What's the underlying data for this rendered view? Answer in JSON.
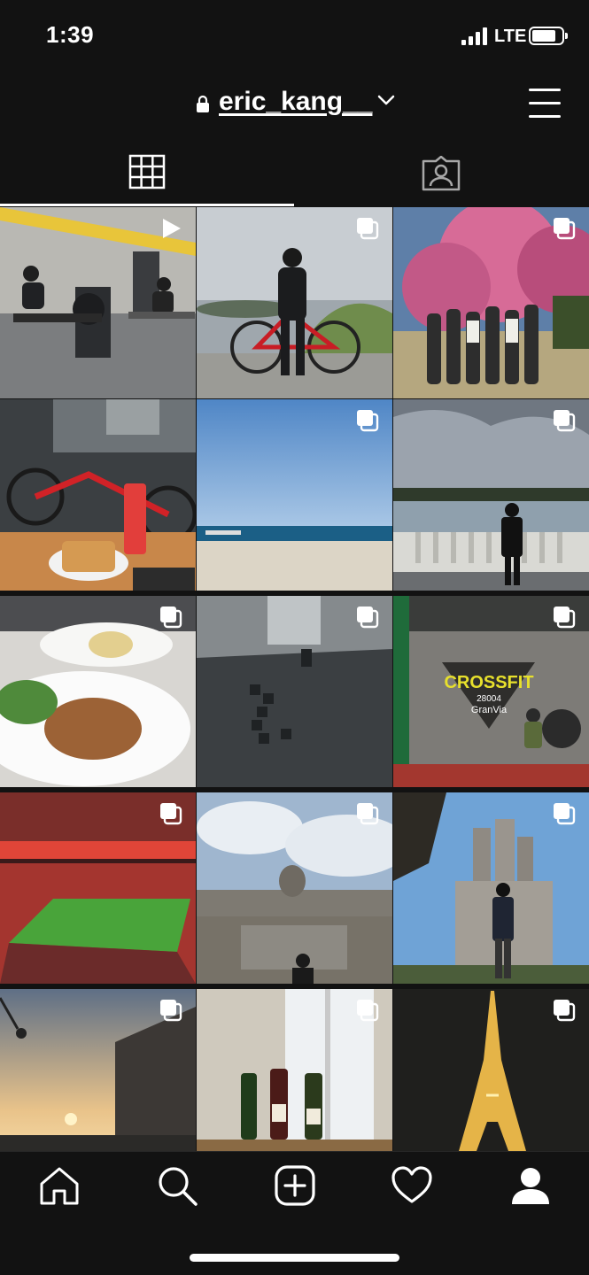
{
  "status_bar": {
    "time": "1:39",
    "network": "LTE"
  },
  "header": {
    "username": "eric_kang__"
  },
  "icons": {
    "lock": "lock-icon",
    "chevron": "chevron-down-icon",
    "menu": "hamburger-menu-icon",
    "grid_tab": "grid-icon",
    "tagged_tab": "tagged-person-icon",
    "home": "home-icon",
    "search": "search-icon",
    "create": "plus-square-icon",
    "activity": "heart-icon",
    "profile": "profile-icon"
  },
  "posts": [
    {
      "id": 1,
      "type": "reel",
      "scene": "gym"
    },
    {
      "id": 2,
      "type": "carousel",
      "scene": "cyclist-by-sea"
    },
    {
      "id": 3,
      "type": "carousel",
      "scene": "group-cherry-blossom"
    },
    {
      "id": 4,
      "type": "none",
      "scene": "cafe-bike-sandwich"
    },
    {
      "id": 5,
      "type": "carousel",
      "scene": "beach"
    },
    {
      "id": 6,
      "type": "carousel",
      "scene": "lake-balustrade"
    },
    {
      "id": 7,
      "type": "carousel",
      "scene": "duck-confit-plate"
    },
    {
      "id": 8,
      "type": "carousel",
      "scene": "city-model"
    },
    {
      "id": 9,
      "type": "carousel",
      "scene": "crossfit-gym"
    },
    {
      "id": 10,
      "type": "carousel",
      "scene": "football-stadium"
    },
    {
      "id": 11,
      "type": "carousel",
      "scene": "palace-fountain"
    },
    {
      "id": 12,
      "type": "carousel",
      "scene": "sagrada-familia"
    },
    {
      "id": 13,
      "type": "carousel",
      "scene": "street-sunset"
    },
    {
      "id": 14,
      "type": "carousel",
      "scene": "wine-bottles"
    },
    {
      "id": 15,
      "type": "carousel",
      "scene": "eiffel-tower-night"
    }
  ],
  "text_overlays": {
    "crossfit_sign": "CROSSFIT",
    "crossfit_number": "28004",
    "crossfit_location": "GranVia"
  }
}
